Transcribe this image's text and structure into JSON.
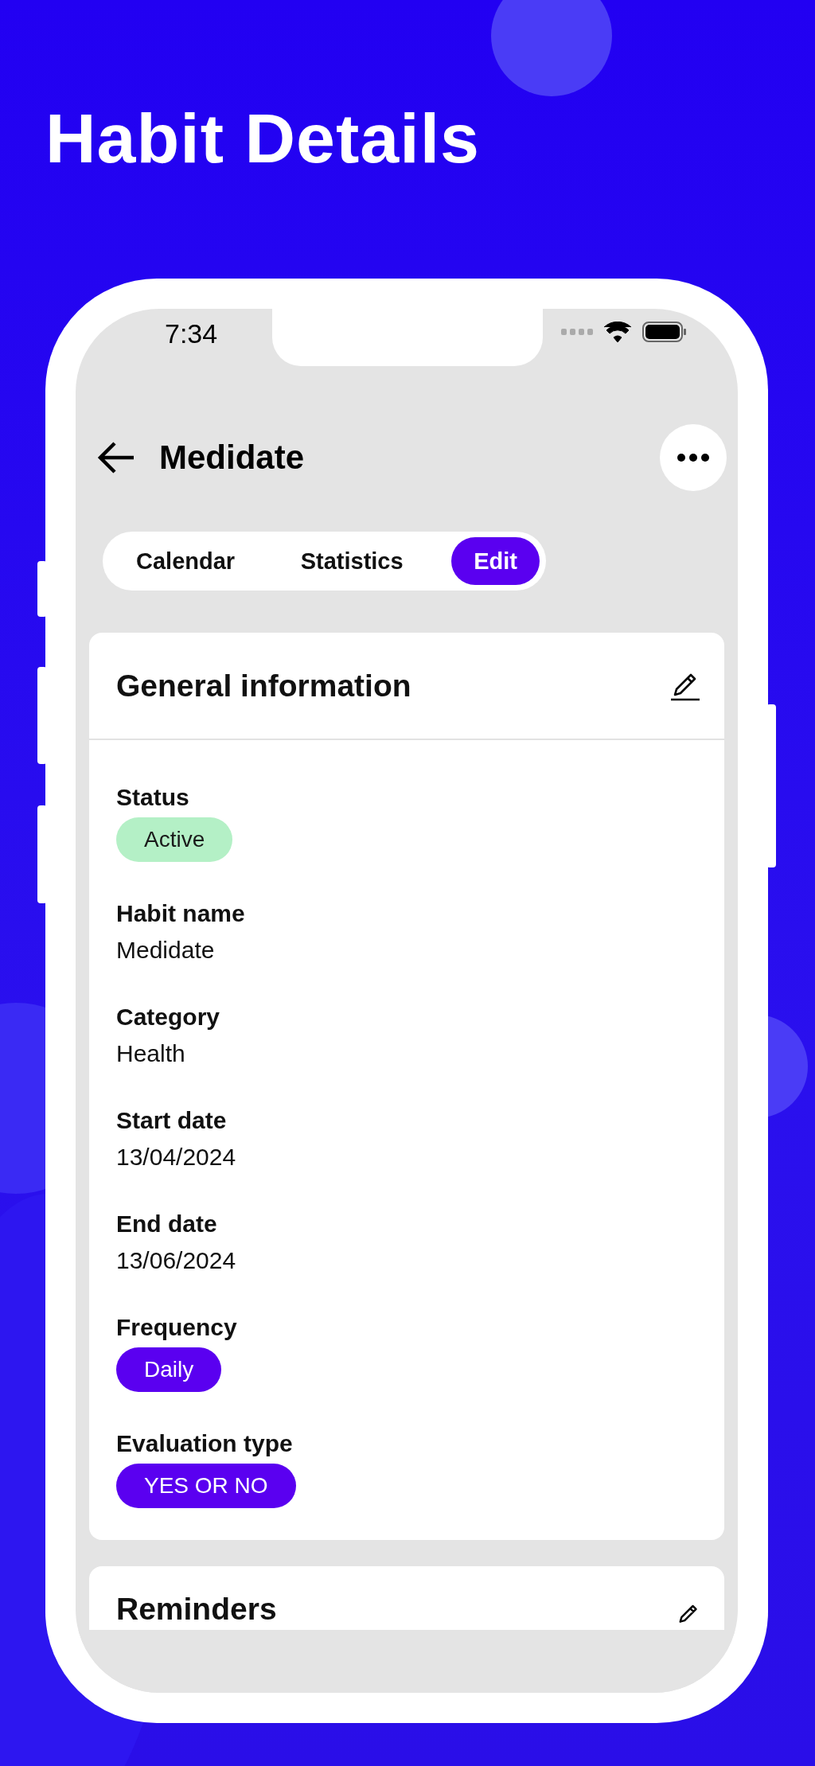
{
  "title": "Habit Details",
  "status_bar": {
    "time": "7:34"
  },
  "header": {
    "title": "Medidate"
  },
  "tabs": [
    {
      "label": "Calendar",
      "selected": false
    },
    {
      "label": "Statistics",
      "selected": false
    },
    {
      "label": "Edit",
      "selected": true
    }
  ],
  "card": {
    "title": "General information",
    "fields": [
      {
        "label": "Status",
        "value": "Active",
        "kind": "status"
      },
      {
        "label": "Habit name",
        "value": "Medidate",
        "kind": "text"
      },
      {
        "label": "Category",
        "value": "Health",
        "kind": "text"
      },
      {
        "label": "Start date",
        "value": "13/04/2024",
        "kind": "text"
      },
      {
        "label": "End date",
        "value": "13/06/2024",
        "kind": "text"
      },
      {
        "label": "Frequency",
        "value": "Daily",
        "kind": "pill"
      },
      {
        "label": "Evaluation type",
        "value": "YES OR NO",
        "kind": "pill"
      }
    ]
  },
  "next_card": {
    "title": "Reminders"
  }
}
